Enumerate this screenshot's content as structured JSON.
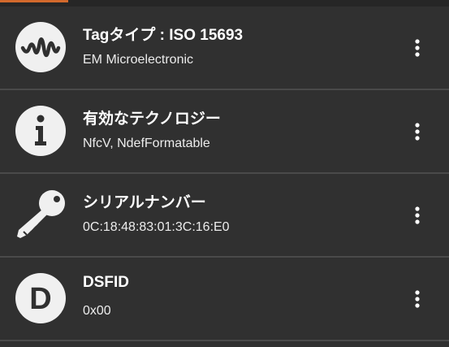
{
  "items": [
    {
      "icon": "waveform-icon",
      "title": "Tagタイプ : ISO 15693",
      "subtitle": "EM Microelectronic"
    },
    {
      "icon": "info-icon",
      "title": "有効なテクノロジー",
      "subtitle": "NfcV, NdefFormatable"
    },
    {
      "icon": "key-icon",
      "title": "シリアルナンバー",
      "subtitle": "0C:18:48:83:01:3C:16:E0"
    },
    {
      "icon": "letter-d-icon",
      "icon_letter": "D",
      "title": "DSFID",
      "subtitle": "0x00"
    }
  ],
  "menu_icon": "more-vert-icon",
  "colors": {
    "background": "#303030",
    "accent": "#d2692c",
    "icon": "#f0f0f0",
    "divider": "#4a4a4a"
  }
}
